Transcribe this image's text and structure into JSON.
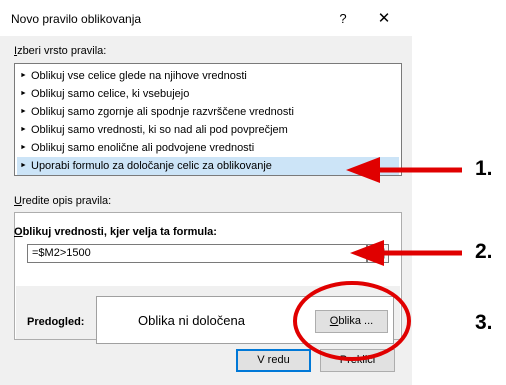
{
  "dialog": {
    "title": "Novo pravilo oblikovanja",
    "help": "?",
    "close": "✕"
  },
  "rule_type": {
    "label_underline": "I",
    "label_rest": "zberi vrsto pravila:",
    "items": [
      "Oblikuj vse celice glede na njihove vrednosti",
      "Oblikuj samo celice, ki vsebujejo",
      "Oblikuj samo zgornje ali spodnje razvrščene vrednosti",
      "Oblikuj samo vrednosti, ki so nad ali pod povprečjem",
      "Oblikuj samo enolične ali podvojene vrednosti",
      "Uporabi formulo za določanje celic za oblikovanje"
    ],
    "selected_index": 5
  },
  "description": {
    "label_underline": "U",
    "label_rest": "redite opis pravila:",
    "formula_label_underline": "O",
    "formula_label_rest": "blikuj vrednosti, kjer velja ta formula:",
    "formula_value": "=$M2>1500",
    "preview_label": "Predogled:",
    "preview_text": "Oblika ni določena",
    "format_button_underline": "O",
    "format_button_rest": "blika ..."
  },
  "buttons": {
    "ok": "V redu",
    "cancel": "Prekliči"
  },
  "annotations": {
    "markers": [
      "1.",
      "2.",
      "3."
    ],
    "color": "#e00000"
  },
  "colors": {
    "selection": "#cce4f7",
    "focus_border": "#0078d7"
  }
}
